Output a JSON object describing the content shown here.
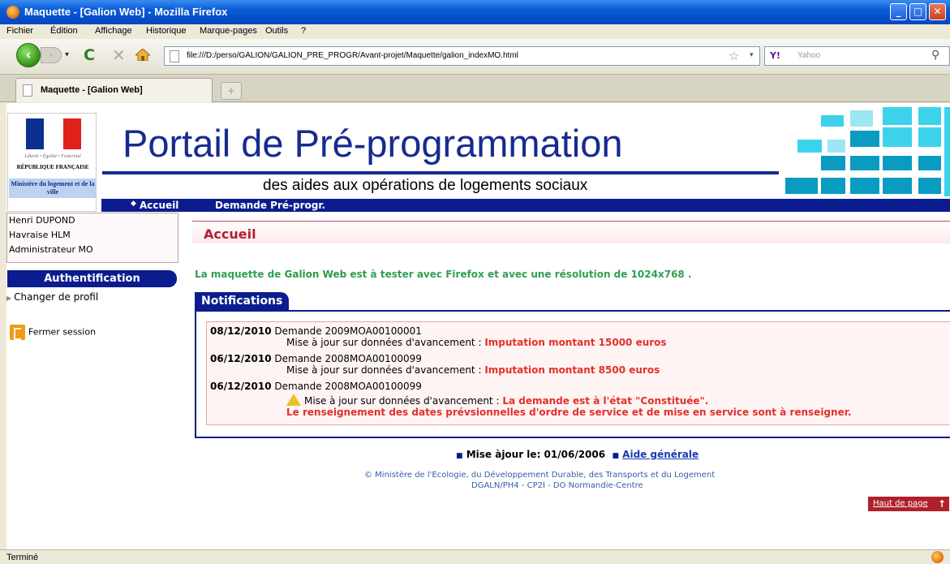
{
  "window": {
    "title": "Maquette - [Galion Web] - Mozilla Firefox"
  },
  "menu": [
    "Fichier",
    "Édition",
    "Affichage",
    "Historique",
    "Marque-pages",
    "Outils",
    "?"
  ],
  "navbar": {
    "url": "file:///D:/perso/GALION/GALION_PRE_PROGR/Avant-projet/Maquette/galion_indexMO.html",
    "search_placeholder": "Yahoo",
    "search_engine": "Y!"
  },
  "tab": {
    "title": "Maquette - [Galion Web]",
    "new_tab": "+"
  },
  "status": "Terminé",
  "page": {
    "logo": {
      "motto": "Liberté • Égalité • Fraternité",
      "republic": "RÉPUBLIQUE FRANÇAISE",
      "ministry": "Ministère du logement et de la ville"
    },
    "title": "Portail de Pré-programmation",
    "subtitle": "des aides aux opérations de logements sociaux",
    "nav": {
      "bullet": "◆",
      "accueil": "Accueil",
      "demande": "Demande Pré-progr."
    },
    "user": {
      "name": "Henri DUPOND",
      "org": "Havraise HLM",
      "role": "Administrateur MO"
    },
    "auth_header": "Authentification",
    "changer_profil": "Changer de profil",
    "fermer_session": "Fermer session",
    "section_title": "Accueil",
    "intro": {
      "p1": "La maquette de ",
      "app": "Galion Web",
      "p2": " est à tester avec ",
      "browser": "Firefox",
      "p3": " et avec une résolution de ",
      "res": "1024x768",
      "p4": " ."
    },
    "notifications_label": "Notifications",
    "notifications": [
      {
        "date": "08/12/2010",
        "demande": "Demande 2009MOA00100001",
        "detail": "Mise à jour sur données d'avancement : ",
        "highlight": "Imputation montant 15000 euros"
      },
      {
        "date": "06/12/2010",
        "demande": "Demande 2008MOA00100099",
        "detail": "Mise à jour sur données d'avancement : ",
        "highlight": "Imputation montant 8500 euros"
      },
      {
        "date": "06/12/2010",
        "demande": "Demande 2008MOA00100099",
        "detail": "Mise à jour sur données d'avancement : ",
        "highlight": "La demande est à l'état \"Constituée\".",
        "highlight2": "Le renseignement des dates prévsionnelles d'ordre de service et de mise en service sont à renseigner."
      }
    ],
    "footer": {
      "maj": "Mise àjour le: 01/06/2006",
      "aide": "Aide générale",
      "copyright": "© Ministère de l'Ecologie, du Développement Durable, des Transports et du Logement",
      "org": "DGALN/PH4 - CP2I - DO Normandie-Centre",
      "haut": "Haut de page"
    }
  },
  "colors": {
    "brand_blue": "#0b1d8e",
    "accent_red": "#b02030",
    "notif_red": "#e2302a",
    "intro_green": "#2fa050"
  }
}
